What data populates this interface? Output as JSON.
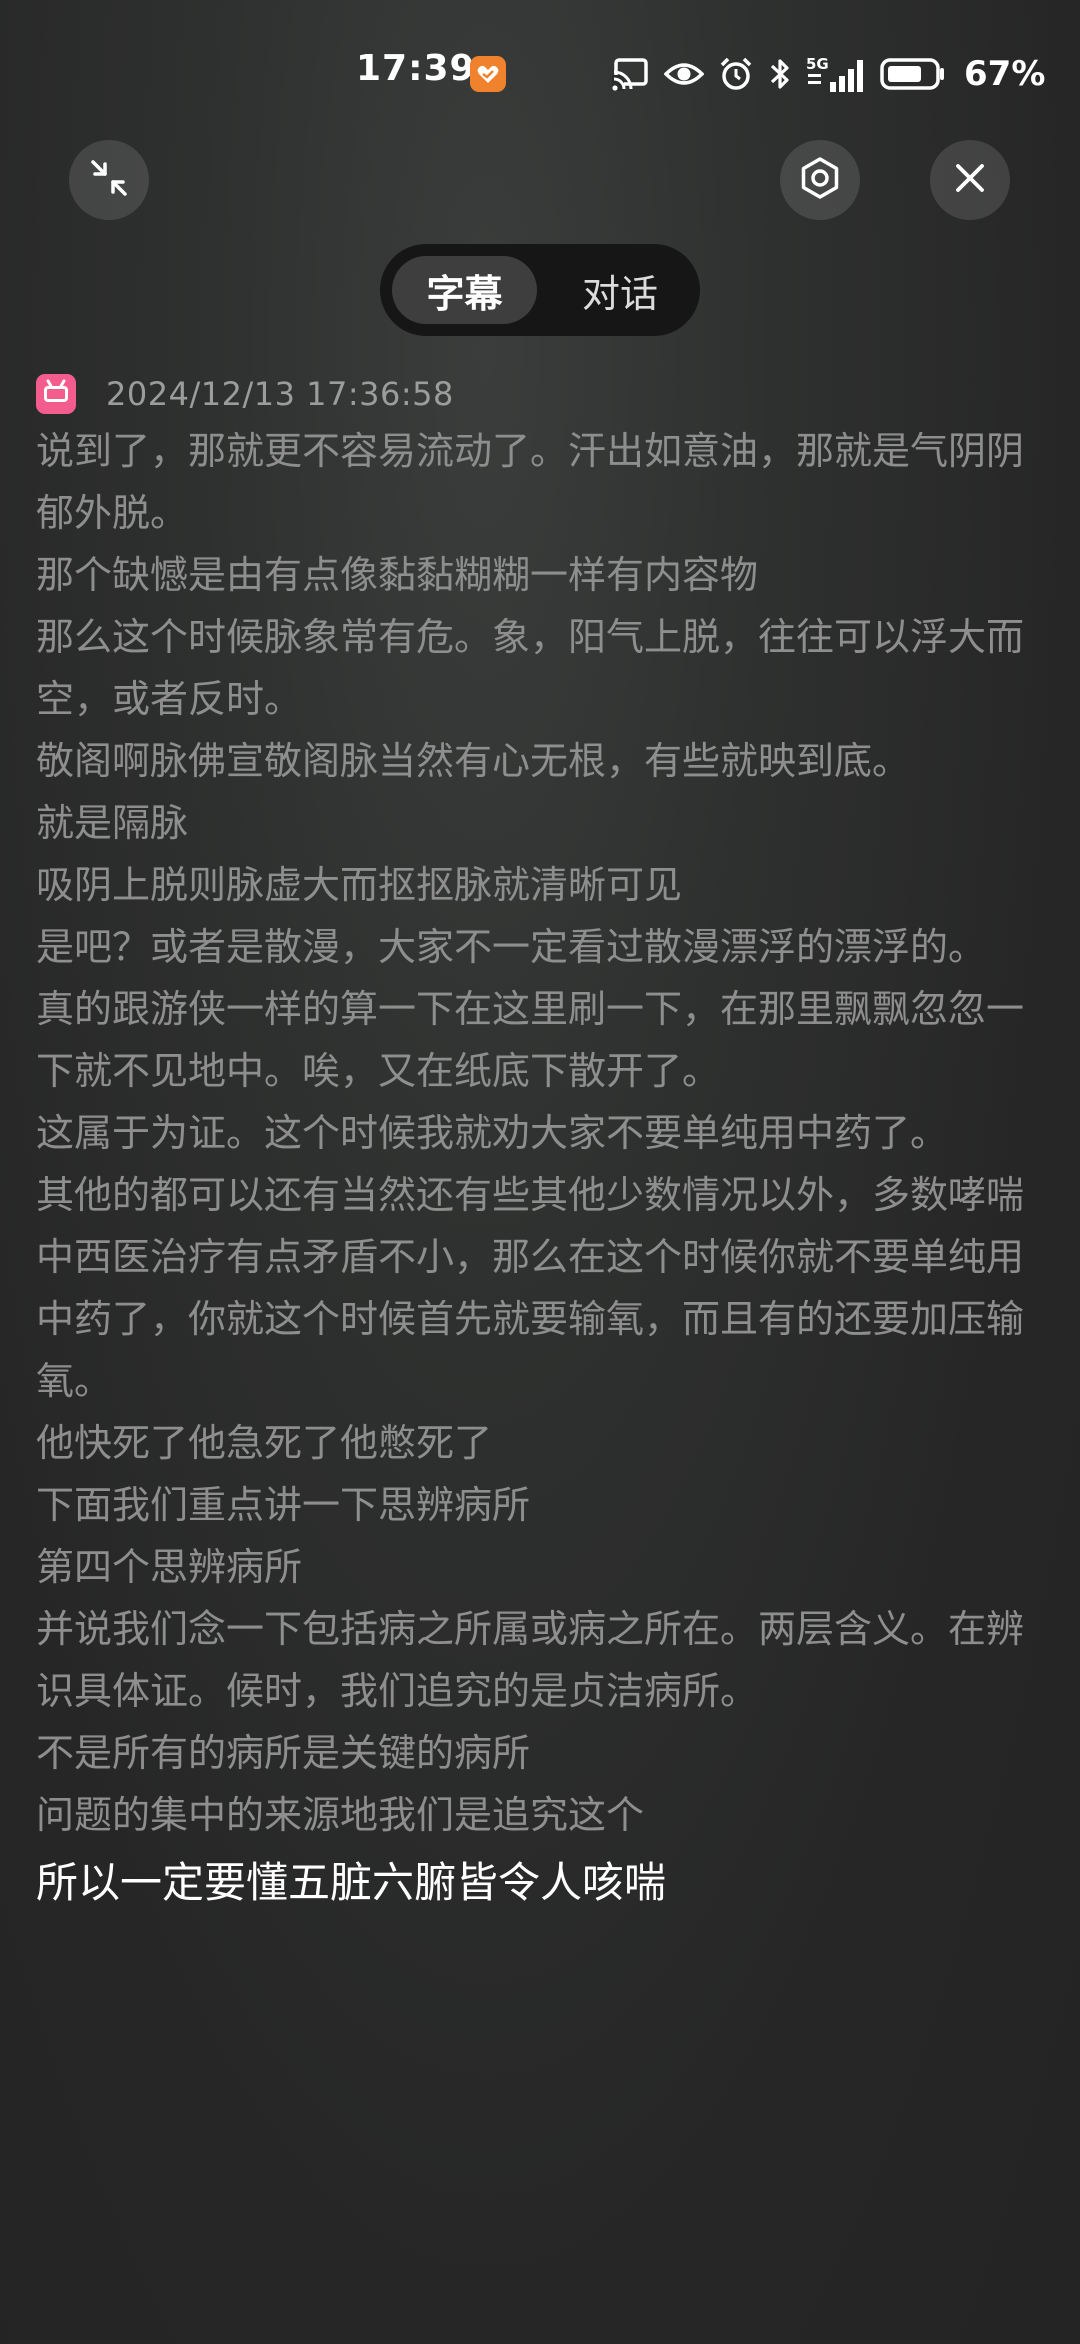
{
  "status_bar": {
    "time": "17:39",
    "battery_percent": "67%",
    "network": "5G",
    "icons": [
      "cast-icon",
      "eye-icon",
      "alarm-icon",
      "bluetooth-icon",
      "signal-icon",
      "battery-icon"
    ]
  },
  "header": {
    "collapse_icon": "collapse-icon",
    "settings_icon": "gear-icon",
    "close_icon": "close-icon"
  },
  "tabs": [
    {
      "label": "字幕",
      "active": true
    },
    {
      "label": "对话",
      "active": false
    }
  ],
  "source": {
    "app_icon": "bilibili-icon",
    "timestamp": "2024/12/13 17:36:58"
  },
  "transcript": {
    "lines": [
      "说到了，那就更不容易流动了。汗出如意油，那就是气阴阴郁外脱。",
      "那个缺憾是由有点像黏黏糊糊一样有内容物",
      "那么这个时候脉象常有危。象，阳气上脱，往往可以浮大而空，或者反时。",
      "敬阁啊脉佛宣敬阁脉当然有心无根，有些就映到底。",
      "就是隔脉",
      "吸阴上脱则脉虚大而抠抠脉就清晰可见",
      "是吧？或者是散漫，大家不一定看过散漫漂浮的漂浮的。",
      "真的跟游侠一样的算一下在这里刷一下，在那里飘飘忽忽一下就不见地中。唉，又在纸底下散开了。",
      "这属于为证。这个时候我就劝大家不要单纯用中药了。",
      "其他的都可以还有当然还有些其他少数情况以外，多数哮喘中西医治疗有点矛盾不小，那么在这个时候你就不要单纯用中药了，你就这个时候首先就要输氧，而且有的还要加压输氧。",
      "他快死了他急死了他憋死了",
      "下面我们重点讲一下思辨病所",
      "第四个思辨病所",
      "并说我们念一下包括病之所属或病之所在。两层含义。在辨识具体证。候时，我们追究的是贞洁病所。",
      "不是所有的病所是关键的病所",
      "问题的集中的来源地我们是追究这个"
    ],
    "current_line": "所以一定要懂五脏六腑皆令人咳喘"
  },
  "colors": {
    "background": "#262626",
    "past_text": "#8e8e8e",
    "current_text": "#ffffff",
    "tab_active_bg": "#3e3e3e",
    "tab_track_bg": "#161616",
    "app_badge": "#f0822d",
    "bilibili_pink": "#f25d8e"
  }
}
